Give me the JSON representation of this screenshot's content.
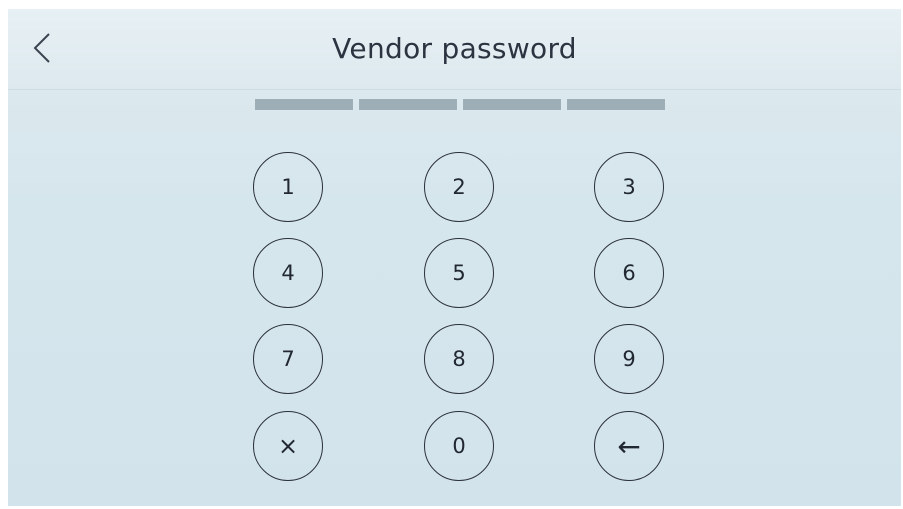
{
  "header": {
    "title": "Vendor password",
    "back_icon": "chevron-left-icon"
  },
  "pin": {
    "length": 4,
    "entered": 0
  },
  "keypad": {
    "keys": [
      {
        "label": "1"
      },
      {
        "label": "2"
      },
      {
        "label": "3"
      },
      {
        "label": "4"
      },
      {
        "label": "5"
      },
      {
        "label": "6"
      },
      {
        "label": "7"
      },
      {
        "label": "8"
      },
      {
        "label": "9"
      },
      {
        "label": "×",
        "icon": "clear-icon"
      },
      {
        "label": "0"
      },
      {
        "label": "←",
        "icon": "backspace-arrow-icon"
      }
    ]
  },
  "colors": {
    "background": "#d6e6ed",
    "header": "#e3edf2",
    "pin_slot": "#9eaeb7",
    "key_outline": "#2a3039",
    "text": "#2b3440"
  }
}
